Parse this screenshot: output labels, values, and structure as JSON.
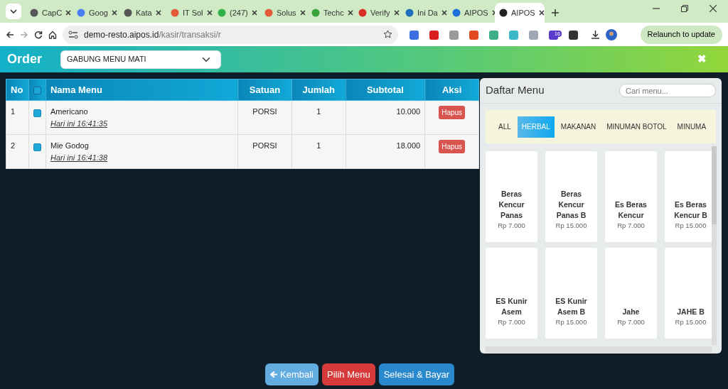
{
  "browser": {
    "tabs": [
      {
        "title": "CapC",
        "selected": false
      },
      {
        "title": "Goog",
        "selected": false
      },
      {
        "title": "Kata",
        "selected": false
      },
      {
        "title": "IT Sol",
        "selected": false
      },
      {
        "title": "(247)",
        "selected": false
      },
      {
        "title": "Solus",
        "selected": false
      },
      {
        "title": "Techc",
        "selected": false
      },
      {
        "title": "Verify",
        "selected": false
      },
      {
        "title": "Ini Da",
        "selected": false
      },
      {
        "title": "AIPOS",
        "selected": false
      },
      {
        "title": "AIPOS",
        "selected": true
      }
    ],
    "url_host": "demo-resto.aipos.id",
    "url_path": "/kasir/transaksi/r",
    "extension_badge": "16",
    "relaunch": "Relaunch to update"
  },
  "app": {
    "title": "Order",
    "select_value": "GABUNG MENU MATI",
    "close": "✖"
  },
  "order_table": {
    "columns": [
      "No",
      "",
      "Nama Menu",
      "Satuan",
      "Jumlah",
      "Subtotal",
      "Aksi"
    ],
    "all_checked": true,
    "rows": [
      {
        "no": "1",
        "checked": true,
        "name": "Americano",
        "time": "Hari ini 16:41:35",
        "unit": "PORSI",
        "qty": "1",
        "subtotal": "10.000",
        "action": "Hapus"
      },
      {
        "no": "2",
        "checked": true,
        "name": "Mie Godog",
        "time": "Hari ini 16:41:38",
        "unit": "PORSI",
        "qty": "1",
        "subtotal": "18.000",
        "action": "Hapus"
      }
    ]
  },
  "menu_panel": {
    "title": "Daftar Menu",
    "search_placeholder": "Cari menu...",
    "categories": [
      {
        "label": "ALL",
        "selected": false
      },
      {
        "label": "HERBAL",
        "selected": true
      },
      {
        "label": "MAKANAN",
        "selected": false
      },
      {
        "label": "MINUMAN BOTOL",
        "selected": false
      },
      {
        "label": "MINUMA",
        "selected": false
      }
    ],
    "items": [
      {
        "name": "Beras Kencur Panas",
        "price": "Rp 7.000"
      },
      {
        "name": "Beras Kencur Panas B",
        "price": "Rp 15.000"
      },
      {
        "name": "Es Beras Kencur",
        "price": "Rp 7.000"
      },
      {
        "name": "Es Beras Kencur B",
        "price": "Rp 15.000"
      },
      {
        "name": "ES Kunir Asem",
        "price": "Rp 7.000"
      },
      {
        "name": "ES Kunir Asem B",
        "price": "Rp 15.000"
      },
      {
        "name": "Jahe",
        "price": "Rp 7.000"
      },
      {
        "name": "JAHE B",
        "price": "Rp 15.000"
      }
    ]
  },
  "buttons": [
    {
      "label": "Kembali",
      "kind": "back"
    },
    {
      "label": "Pilih Menu",
      "kind": "danger"
    },
    {
      "label": "Selesai & Bayar",
      "kind": "primary"
    }
  ]
}
